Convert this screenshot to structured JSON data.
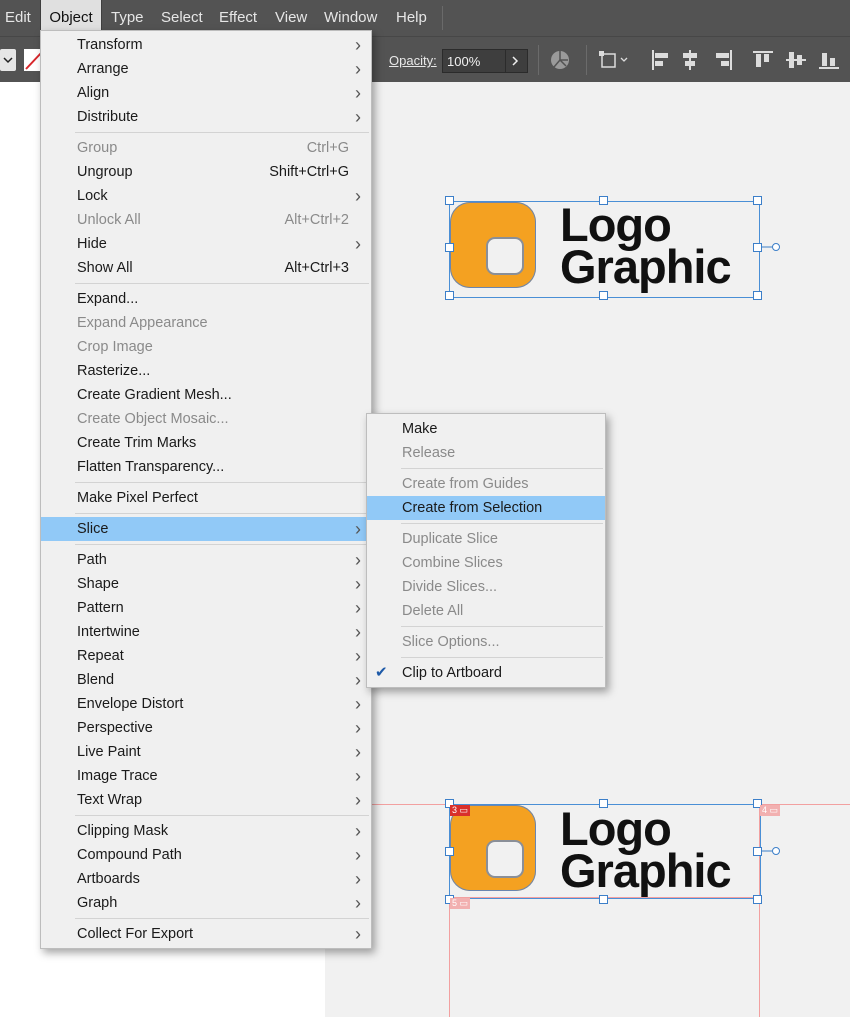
{
  "menubar": {
    "items": [
      "Edit",
      "Object",
      "Type",
      "Select",
      "Effect",
      "View",
      "Window",
      "Help"
    ],
    "active": "Object"
  },
  "controlbar": {
    "opacity_label": "Opacity:",
    "opacity_value": "100%"
  },
  "object_menu": {
    "items": [
      {
        "label": "Transform",
        "submenu": true
      },
      {
        "label": "Arrange",
        "submenu": true
      },
      {
        "label": "Align",
        "submenu": true
      },
      {
        "label": "Distribute",
        "submenu": true
      },
      {
        "separator": true
      },
      {
        "label": "Group",
        "shortcut": "Ctrl+G",
        "disabled": true
      },
      {
        "label": "Ungroup",
        "shortcut": "Shift+Ctrl+G"
      },
      {
        "label": "Lock",
        "submenu": true
      },
      {
        "label": "Unlock All",
        "shortcut": "Alt+Ctrl+2",
        "disabled": true
      },
      {
        "label": "Hide",
        "submenu": true
      },
      {
        "label": "Show All",
        "shortcut": "Alt+Ctrl+3"
      },
      {
        "separator": true
      },
      {
        "label": "Expand..."
      },
      {
        "label": "Expand Appearance",
        "disabled": true
      },
      {
        "label": "Crop Image",
        "disabled": true
      },
      {
        "label": "Rasterize..."
      },
      {
        "label": "Create Gradient Mesh..."
      },
      {
        "label": "Create Object Mosaic...",
        "disabled": true
      },
      {
        "label": "Create Trim Marks"
      },
      {
        "label": "Flatten Transparency..."
      },
      {
        "separator": true
      },
      {
        "label": "Make Pixel Perfect"
      },
      {
        "separator": true
      },
      {
        "label": "Slice",
        "submenu": true,
        "highlighted": true
      },
      {
        "separator": true
      },
      {
        "label": "Path",
        "submenu": true
      },
      {
        "label": "Shape",
        "submenu": true
      },
      {
        "label": "Pattern",
        "submenu": true
      },
      {
        "label": "Intertwine",
        "submenu": true
      },
      {
        "label": "Repeat",
        "submenu": true
      },
      {
        "label": "Blend",
        "submenu": true
      },
      {
        "label": "Envelope Distort",
        "submenu": true
      },
      {
        "label": "Perspective",
        "submenu": true
      },
      {
        "label": "Live Paint",
        "submenu": true
      },
      {
        "label": "Image Trace",
        "submenu": true
      },
      {
        "label": "Text Wrap",
        "submenu": true
      },
      {
        "separator": true
      },
      {
        "label": "Clipping Mask",
        "submenu": true
      },
      {
        "label": "Compound Path",
        "submenu": true
      },
      {
        "label": "Artboards",
        "submenu": true
      },
      {
        "label": "Graph",
        "submenu": true
      },
      {
        "separator": true
      },
      {
        "label": "Collect For Export",
        "submenu": true
      }
    ]
  },
  "slice_submenu": {
    "items": [
      {
        "label": "Make"
      },
      {
        "label": "Release",
        "disabled": true
      },
      {
        "separator": true
      },
      {
        "label": "Create from Guides",
        "disabled": true
      },
      {
        "label": "Create from Selection",
        "highlighted": true
      },
      {
        "separator": true
      },
      {
        "label": "Duplicate Slice",
        "disabled": true
      },
      {
        "label": "Combine Slices",
        "disabled": true
      },
      {
        "label": "Divide Slices...",
        "disabled": true
      },
      {
        "label": "Delete All",
        "disabled": true
      },
      {
        "separator": true
      },
      {
        "label": "Slice Options...",
        "disabled": true
      },
      {
        "separator": true
      },
      {
        "label": "Clip to Artboard",
        "checked": true
      }
    ]
  },
  "artwork": {
    "logo_line1": "Logo",
    "logo_line2": "Graphic",
    "logo_color": "#f4a121",
    "slice_numbers": [
      "3",
      "4",
      "5"
    ]
  },
  "icons": {
    "checkmark": "check-icon",
    "submenu_arrow": "chevron-right-icon"
  },
  "colors": {
    "menu_highlight": "#91c9f7",
    "selection": "#3c7fc9",
    "slice_guide": "#f2a0a0"
  }
}
